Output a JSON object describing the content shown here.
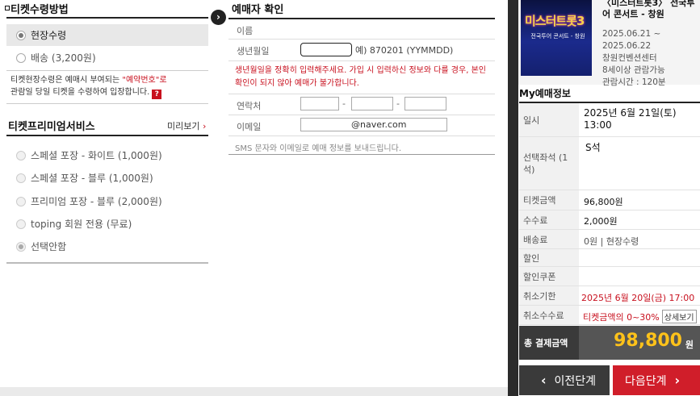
{
  "ticket_receipt": {
    "title": "티켓수령방법",
    "options": [
      {
        "label": "현장수령",
        "selected": true
      },
      {
        "label": "배송 (3,200원)",
        "selected": false
      }
    ],
    "notice_prefix": "티켓현장수령은 예매시 부여되는 ",
    "notice_highlight": "\"예약번호\"로",
    "notice_suffix": "관람일 당일 티켓을 수령하여 입장합니다.",
    "help_icon": "?"
  },
  "premium": {
    "title": "티켓프리미엄서비스",
    "preview_label": "미리보기",
    "options": [
      {
        "label": "스페셜 포장 - 화이트 (1,000원)",
        "selected": false
      },
      {
        "label": "스페셜 포장 - 블루 (1,000원)",
        "selected": false
      },
      {
        "label": "프리미엄 포장 - 블루 (2,000원)",
        "selected": false
      },
      {
        "label": "toping 회원 전용 (무료)",
        "selected": false
      },
      {
        "label": "선택안함",
        "selected": true
      }
    ]
  },
  "booker": {
    "title": "예매자 확인",
    "name_label": "이름",
    "birth_label": "생년월일",
    "birth_hint": "예) 870201 (YYMMDD)",
    "birth_warning": "생년월일을 정확히 입력해주세요. 가입 시 입력하신 정보와 다를 경우, 본인확인이 되지 않아 예매가 불가합니다.",
    "phone_label": "연락처",
    "phone_sep": "-",
    "email_label": "이메일",
    "email_value": "@naver.com",
    "sms_note": "SMS 문자와 이메일로 예매 정보를 보내드립니다."
  },
  "show": {
    "title": "〈미스터트롯3〉 전국투어 콘서트 - 창원",
    "poster_title": "미스터트롯3",
    "poster_sub": "전국투어 콘서트 - 창원",
    "date_range_start": "2025.06.21 ~",
    "date_range_end": "2025.06.22",
    "venue": "창원컨벤션센터",
    "age": "8세이상 관람가능",
    "runtime": "관람시간 : 120분"
  },
  "my_booking": {
    "title": "My예매정보",
    "rows": [
      {
        "label": "일시",
        "value": "2025년 6월 21일(토) 13:00"
      },
      {
        "label": "선택좌석 (1석)",
        "value": "S석"
      },
      {
        "label": "티켓금액",
        "value": "96,800원"
      },
      {
        "label": "수수료",
        "value": "2,000원"
      },
      {
        "label": "배송료",
        "value": "0원 | 현장수령"
      },
      {
        "label": "할인",
        "value": ""
      },
      {
        "label": "할인쿠폰",
        "value": ""
      },
      {
        "label": "취소기한",
        "value": "2025년 6월 20일(금) 17:00"
      },
      {
        "label": "취소수수료",
        "value": "티켓금액의 0~30%"
      }
    ],
    "detail_button": "상세보기",
    "total_label": "총 결제금액",
    "total_amount": "98,800",
    "total_unit": "원"
  },
  "nav": {
    "prev_label": "이전단계",
    "next_label": "다음단계"
  },
  "colors": {
    "accent_red": "#d01e2a",
    "total_amount": "#ffc21a",
    "dark": "#3a3a3a"
  }
}
